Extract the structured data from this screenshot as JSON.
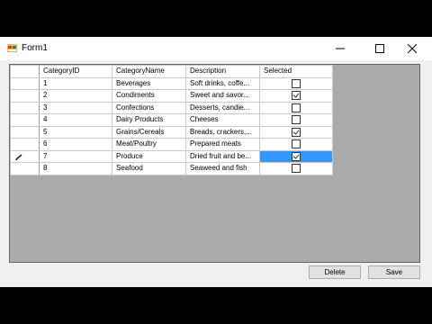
{
  "window": {
    "title": "Form1"
  },
  "grid": {
    "columns": [
      "CategoryID",
      "CategoryName",
      "Description",
      "Selected"
    ],
    "rows": [
      {
        "id": "1",
        "name": "Beverages",
        "description": "Soft drinks, coffe...",
        "selected": false
      },
      {
        "id": "2",
        "name": "Condiments",
        "description": "Sweet and savor...",
        "selected": true
      },
      {
        "id": "3",
        "name": "Confections",
        "description": "Desserts, candie...",
        "selected": false
      },
      {
        "id": "4",
        "name": "Dairy Products",
        "description": "Cheeses",
        "selected": false
      },
      {
        "id": "5",
        "name": "Grains/Cereals",
        "description": "Breads, crackers,...",
        "selected": true
      },
      {
        "id": "6",
        "name": "Meat/Poultry",
        "description": "Prepared meats",
        "selected": false
      },
      {
        "id": "7",
        "name": "Produce",
        "description": "Dried fruit and be...",
        "selected": true,
        "current": true
      },
      {
        "id": "8",
        "name": "Seafood",
        "description": "Seaweed and fish",
        "selected": false
      }
    ]
  },
  "buttons": {
    "delete": "Delete",
    "save": "Save"
  },
  "icons": {
    "row_editing": "pencil-icon",
    "app": "form-icon"
  }
}
